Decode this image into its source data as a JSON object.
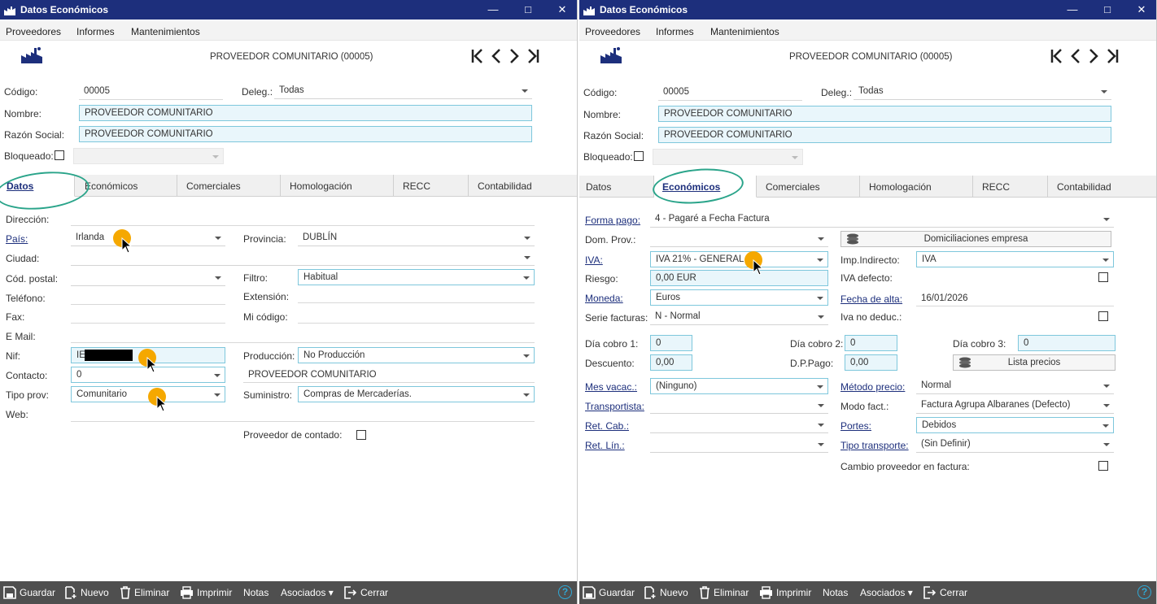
{
  "window_title": "Datos Económicos",
  "menu": [
    "Proveedores",
    "Informes",
    "Mantenimientos"
  ],
  "record_title": "PROVEEDOR COMUNITARIO (00005)",
  "nav_icons": [
    "first-icon",
    "prev-icon",
    "next-icon",
    "last-icon"
  ],
  "header": {
    "codigo_label": "Código:",
    "codigo_value": "00005",
    "deleg_label": "Deleg.:",
    "deleg_value": "Todas",
    "nombre_label": "Nombre:",
    "nombre_value": "PROVEEDOR COMUNITARIO",
    "razon_label": "Razón Social:",
    "razon_value": "PROVEEDOR COMUNITARIO",
    "bloqueado_label": "Bloqueado:"
  },
  "tabs": [
    "Datos",
    "Económicos",
    "Comerciales",
    "Homologación",
    "RECC",
    "Contabilidad"
  ],
  "left": {
    "direccion_label": "Dirección:",
    "pais_label": "País:",
    "pais_value": "Irlanda",
    "provincia_label": "Provincia:",
    "provincia_value": "DUBLÍN",
    "ciudad_label": "Ciudad:",
    "cp_label": "Cód. postal:",
    "filtro_label": "Filtro:",
    "filtro_value": "Habitual",
    "telefono_label": "Teléfono:",
    "extension_label": "Extensión:",
    "fax_label": "Fax:",
    "micodigo_label": "Mi código:",
    "email_label": "E Mail:",
    "nif_label": "Nif:",
    "nif_value": "IE",
    "produccion_label": "Producción:",
    "produccion_value": "No Producción",
    "contacto_label": "Contacto:",
    "contacto_value": "0",
    "contacto_name": "PROVEEDOR COMUNITARIO",
    "tipoprov_label": "Tipo prov:",
    "tipoprov_value": "Comunitario",
    "suministro_label": "Suministro:",
    "suministro_value": "Compras de Mercaderías.",
    "web_label": "Web:",
    "contado_label": "Proveedor de contado:"
  },
  "right": {
    "formapago_label": "Forma pago:",
    "formapago_value": "4 - Pagaré a Fecha Factura",
    "domprov_label": "Dom. Prov.:",
    "domic_button": "Domiciliaciones empresa",
    "iva_label": "IVA:",
    "iva_value": "IVA 21% - GENERAL",
    "impind_label": "Imp.Indirecto:",
    "impind_value": "IVA",
    "riesgo_label": "Riesgo:",
    "riesgo_value": "0,00 EUR",
    "ivadef_label": "IVA defecto:",
    "moneda_label": "Moneda:",
    "moneda_value": "Euros",
    "fechaalta_label": "Fecha de alta:",
    "fechaalta_value": "16/01/2026",
    "serie_label": "Serie facturas:",
    "serie_value": "N - Normal",
    "ivanoded_label": "Iva no deduc.:",
    "dia1_label": "Día cobro 1:",
    "dia1_value": "0",
    "dia2_label": "Día cobro 2:",
    "dia2_value": "0",
    "dia3_label": "Día cobro 3:",
    "dia3_value": "0",
    "descuento_label": "Descuento:",
    "descuento_value": "0,00",
    "dppago_label": "D.P.Pago:",
    "dppago_value": "0,00",
    "lista_button": "Lista precios",
    "mesvacac_label": "Mes vacac.:",
    "mesvacac_value": "(Ninguno)",
    "metodo_label": "Método precio:",
    "metodo_value": "Normal",
    "transportista_label": "Transportista:",
    "modofact_label": "Modo fact.:",
    "modofact_value": "Factura Agrupa Albaranes (Defecto)",
    "retcab_label": "Ret. Cab.:",
    "portes_label": "Portes:",
    "portes_value": "Debidos",
    "retlin_label": "Ret. Lín.:",
    "tipotransp_label": "Tipo transporte:",
    "tipotransp_value": "(Sin Definir)",
    "cambio_label": "Cambio proveedor en factura:"
  },
  "statusbar": {
    "guardar": "Guardar",
    "nuevo": "Nuevo",
    "eliminar": "Eliminar",
    "imprimir": "Imprimir",
    "notas": "Notas",
    "asociados": "Asociados",
    "cerrar": "Cerrar",
    "help": "?"
  },
  "colors": {
    "titlebar": "#1d2f7c",
    "accent": "#1d2f7c",
    "field_border": "#7ec7dc",
    "field_bg": "#e9f6fb",
    "highlight_oval": "#2aa48a",
    "marker": "#f5a800",
    "statusbar": "#4f4f4f"
  }
}
